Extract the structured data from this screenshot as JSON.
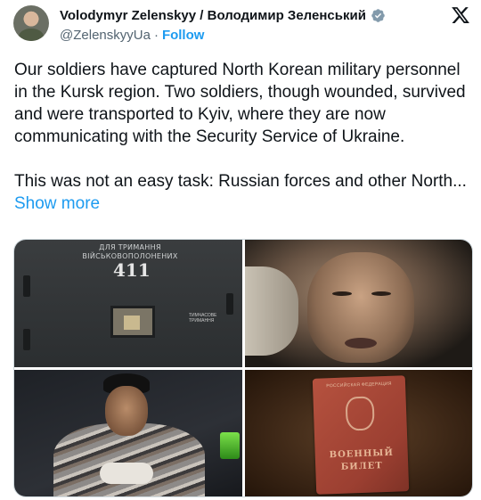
{
  "author": {
    "display_name": "Volodymyr Zelenskyy / Володимир Зеленський",
    "handle": "@ZelenskyyUa",
    "separator": "·",
    "follow_label": "Follow",
    "verified_color": "#829aab"
  },
  "platform_icon": "x-logo-icon",
  "tweet": {
    "paragraph_1": "Our soldiers have captured North Korean military personnel in the Kursk region. Two soldiers, though wounded, survived and were transported to Kyiv, where they are now communicating with the Security Service of Ukraine.",
    "paragraph_2": "This was not an easy task: Russian forces and other North...",
    "show_more_label": "Show more"
  },
  "media": {
    "photo1": {
      "sign_text": "ДЛЯ ТРИМАННЯ ВІЙСЬКОВОПОЛОНЕНИХ",
      "door_number": "411",
      "label_text": "ТИМЧАСОВЕ ТРИМАННЯ"
    },
    "photo4": {
      "top_text": "РОССИЙСКАЯ ФЕДЕРАЦИЯ",
      "title_line1": "ВОЕННЫЙ",
      "title_line2": "БИЛЕТ"
    }
  },
  "colors": {
    "link": "#1d9bf0",
    "text": "#0f1419",
    "secondary": "#536471"
  }
}
